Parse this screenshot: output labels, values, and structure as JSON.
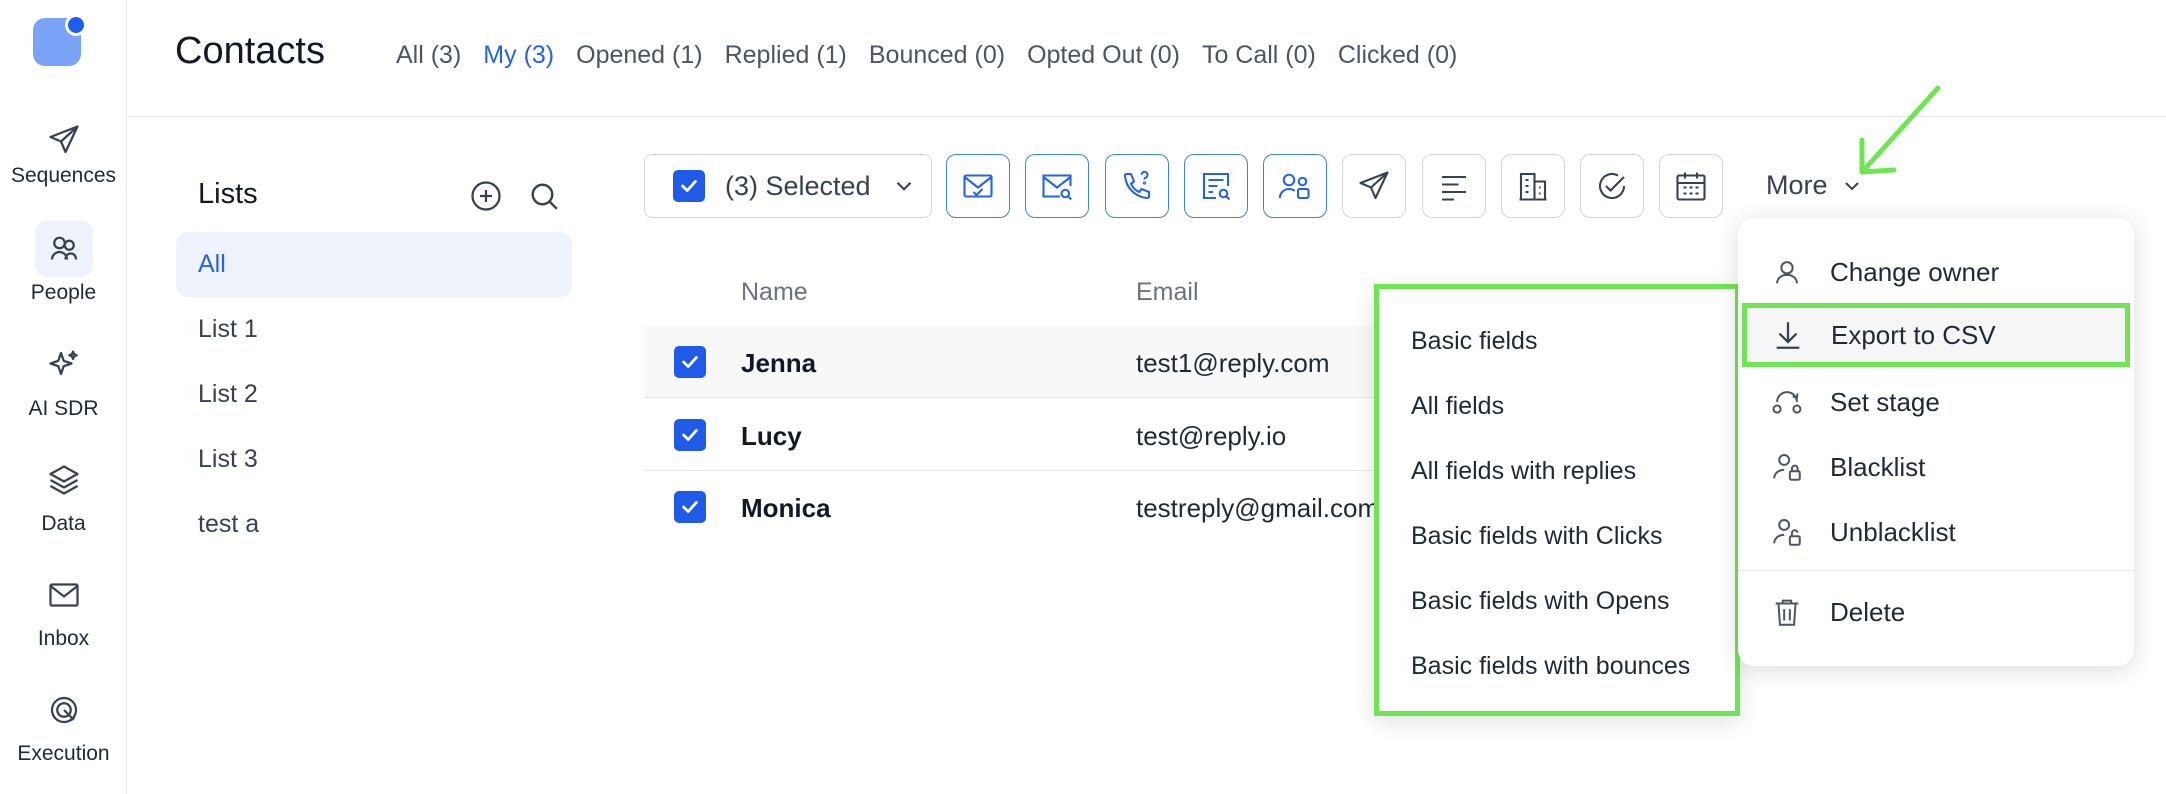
{
  "nav": {
    "items": [
      {
        "label": "Sequences",
        "icon": "paper-plane-icon"
      },
      {
        "label": "People",
        "icon": "people-icon"
      },
      {
        "label": "AI SDR",
        "icon": "sparkle-icon"
      },
      {
        "label": "Data",
        "icon": "layers-icon"
      },
      {
        "label": "Inbox",
        "icon": "envelope-icon"
      },
      {
        "label": "Execution",
        "icon": "target-icon"
      }
    ]
  },
  "header": {
    "title": "Contacts",
    "tabs": [
      {
        "label": "All (3)"
      },
      {
        "label": "My (3)"
      },
      {
        "label": "Opened (1)"
      },
      {
        "label": "Replied (1)"
      },
      {
        "label": "Bounced (0)"
      },
      {
        "label": "Opted Out (0)"
      },
      {
        "label": "To Call (0)"
      },
      {
        "label": "Clicked (0)"
      }
    ]
  },
  "lists": {
    "title": "Lists",
    "items": [
      {
        "label": "All"
      },
      {
        "label": "List 1"
      },
      {
        "label": "List 2"
      },
      {
        "label": "List 3"
      },
      {
        "label": "test a"
      }
    ]
  },
  "toolbar": {
    "selected_label": "(3) Selected",
    "more_label": "More"
  },
  "table": {
    "columns": {
      "name": "Name",
      "email": "Email"
    },
    "rows": [
      {
        "name": "Jenna",
        "email": "test1@reply.com"
      },
      {
        "name": "Lucy",
        "email": "test@reply.io"
      },
      {
        "name": "Monica",
        "email": "testreply@gmail.com"
      }
    ]
  },
  "export_submenu": {
    "items": [
      {
        "label": "Basic fields"
      },
      {
        "label": "All fields"
      },
      {
        "label": "All fields with replies"
      },
      {
        "label": "Basic fields with Clicks"
      },
      {
        "label": "Basic fields with Opens"
      },
      {
        "label": "Basic fields with bounces"
      }
    ]
  },
  "more_menu": {
    "items": [
      {
        "label": "Change owner",
        "icon": "user-icon"
      },
      {
        "label": "Export to CSV",
        "icon": "download-icon"
      },
      {
        "label": "Set stage",
        "icon": "stage-icon"
      },
      {
        "label": "Blacklist",
        "icon": "user-lock-icon"
      },
      {
        "label": "Unblacklist",
        "icon": "user-unlock-icon"
      },
      {
        "label": "Delete",
        "icon": "trash-icon"
      }
    ]
  },
  "colors": {
    "accent": "#2563eb",
    "checkbox": "#1f5ae8",
    "highlight": "#6ee651"
  }
}
